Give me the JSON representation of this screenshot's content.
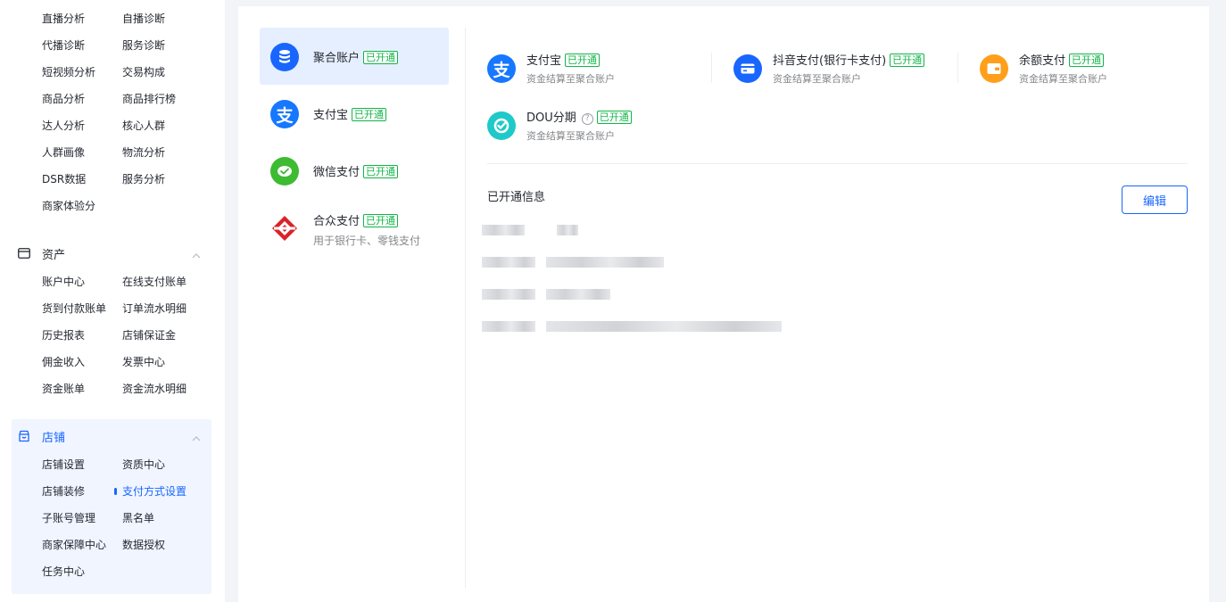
{
  "sidebar": {
    "top_items": [
      [
        "直播分析",
        "自播诊断"
      ],
      [
        "代播诊断",
        "服务诊断"
      ],
      [
        "短视频分析",
        "交易构成"
      ],
      [
        "商品分析",
        "商品排行榜"
      ],
      [
        "达人分析",
        "核心人群"
      ],
      [
        "人群画像",
        "物流分析"
      ],
      [
        "DSR数据",
        "服务分析"
      ],
      [
        "商家体验分",
        ""
      ]
    ],
    "assets": {
      "title": "资产",
      "items": [
        [
          "账户中心",
          "在线支付账单"
        ],
        [
          "货到付款账单",
          "订单流水明细"
        ],
        [
          "历史报表",
          "店铺保证金"
        ],
        [
          "佣金收入",
          "发票中心"
        ],
        [
          "资金账单",
          "资金流水明细"
        ]
      ]
    },
    "store": {
      "title": "店铺",
      "items": [
        [
          "店铺设置",
          "资质中心"
        ],
        [
          "店铺装修",
          "支付方式设置"
        ],
        [
          "子账号管理",
          "黑名单"
        ],
        [
          "商家保障中心",
          "数据授权"
        ],
        [
          "任务中心",
          ""
        ]
      ],
      "active_item": "支付方式设置"
    }
  },
  "methods": [
    {
      "name": "聚合账户",
      "badge": "已开通",
      "icon": "database-icon",
      "color": "#1966ff",
      "active": true,
      "sub": ""
    },
    {
      "name": "支付宝",
      "badge": "已开通",
      "icon": "alipay-icon",
      "color": "#1677ff",
      "active": false,
      "sub": ""
    },
    {
      "name": "微信支付",
      "badge": "已开通",
      "icon": "wechat-pay-icon",
      "color": "#3dbb32",
      "active": false,
      "sub": ""
    },
    {
      "name": "合众支付",
      "badge": "已开通",
      "icon": "hezhong-icon",
      "color": "#d9232a",
      "active": false,
      "sub": "用于银行卡、零钱支付"
    }
  ],
  "channels": [
    {
      "name": "支付宝",
      "badge": "已开通",
      "sub": "资金结算至聚合账户",
      "icon": "alipay-icon",
      "color": "#1677ff"
    },
    {
      "name": "抖音支付(银行卡支付)",
      "badge": "已开通",
      "sub": "资金结算至聚合账户",
      "icon": "bank-card-icon",
      "color": "#1966ff"
    },
    {
      "name": "余额支付",
      "badge": "已开通",
      "sub": "资金结算至聚合账户",
      "icon": "wallet-icon",
      "color": "#ff9f1a"
    },
    {
      "name": "DOU分期",
      "badge": "已开通",
      "sub": "资金结算至聚合账户",
      "icon": "dou-installment-icon",
      "color": "#1fc9c9",
      "help": "?"
    }
  ],
  "info": {
    "title": "已开通信息",
    "edit_label": "编辑"
  }
}
